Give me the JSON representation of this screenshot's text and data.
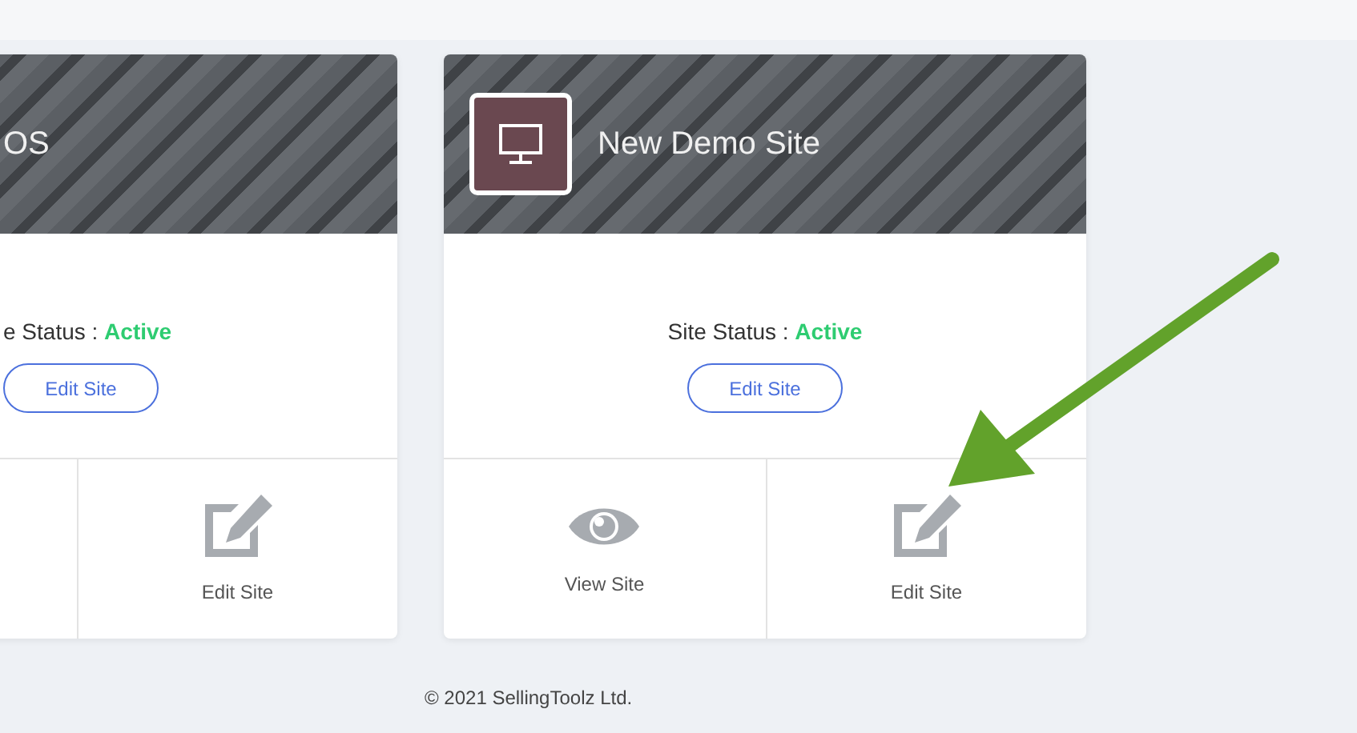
{
  "cards": [
    {
      "title": "OS",
      "icon": false,
      "status_label": "e Status :",
      "status": "Active",
      "button": "Edit Site",
      "actions": [
        {
          "kind": "blank"
        },
        {
          "kind": "edit",
          "label": "Edit Site"
        }
      ]
    },
    {
      "title": "New Demo Site",
      "icon": true,
      "status_label": "Site Status :",
      "status": "Active",
      "button": "Edit Site",
      "actions": [
        {
          "kind": "view",
          "label": "View Site"
        },
        {
          "kind": "edit",
          "label": "Edit Site"
        }
      ]
    }
  ],
  "footer": "© 2021 SellingToolz Ltd."
}
